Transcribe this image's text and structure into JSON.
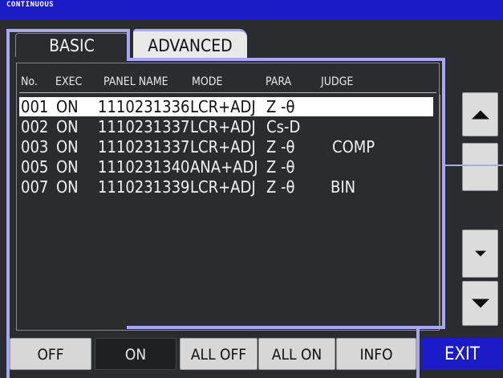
{
  "window": {
    "title": "CONTINUOUS"
  },
  "tabs": [
    {
      "label": "BASIC",
      "active": true
    },
    {
      "label": "ADVANCED",
      "active": false
    }
  ],
  "list": {
    "headers": {
      "no": "No.",
      "exec": "EXEC",
      "panel_name": "PANEL NAME",
      "mode": "MODE",
      "para": "PARA",
      "judge": "JUDGE"
    },
    "rows": [
      {
        "no": "001",
        "exec": "ON",
        "panel_name": "1110231336",
        "mode": "LCR+ADJ",
        "para": "Z -θ",
        "judge": "",
        "selected": true
      },
      {
        "no": "002",
        "exec": "ON",
        "panel_name": "1110231337",
        "mode": "LCR+ADJ",
        "para": "Cs-D",
        "judge": "",
        "selected": false
      },
      {
        "no": "003",
        "exec": "ON",
        "panel_name": "1110231337",
        "mode": "LCR+ADJ",
        "para": "Z -θ",
        "judge": "COMP",
        "selected": false
      },
      {
        "no": "005",
        "exec": "ON",
        "panel_name": "1110231340",
        "mode": "ANA+ADJ",
        "para": "Z -θ",
        "judge": "",
        "selected": false
      },
      {
        "no": "007",
        "exec": "ON",
        "panel_name": "1110231339",
        "mode": "LCR+ADJ",
        "para": "Z -θ",
        "judge": "BIN",
        "selected": false
      }
    ]
  },
  "buttons": {
    "off": "OFF",
    "on": "ON",
    "all_off": "ALL OFF",
    "all_on": "ALL ON",
    "info": "INFO",
    "exit": "EXIT"
  },
  "side_buttons": [
    "scroll-up-icon",
    "",
    "",
    "page-down-icon",
    "scroll-down-icon"
  ],
  "colors": {
    "title_bar": "#1b1bc8",
    "background": "#2a2c2f",
    "highlight_outline": "#a7a7f4",
    "button_face": "#d7d7d7",
    "exit_button": "#1b1bc8"
  }
}
